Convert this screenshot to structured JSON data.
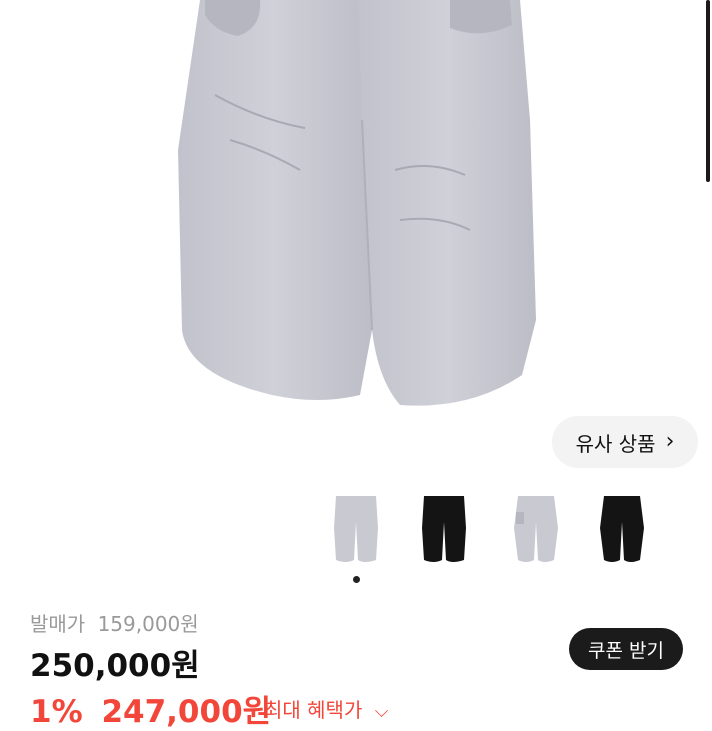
{
  "similar_button": {
    "label": "유사 상품",
    "icon": "chevron-right-icon"
  },
  "thumbnails": [
    {
      "name": "light-gray-pants-front",
      "color": "#c9c9d1"
    },
    {
      "name": "black-pants-front",
      "color": "#141414"
    },
    {
      "name": "light-gray-pants-side",
      "color": "#c9c9d1"
    },
    {
      "name": "black-pants-side",
      "color": "#141414"
    }
  ],
  "pricing": {
    "original_label": "발매가",
    "original_price": "159,000원",
    "price": "250,000원",
    "discount_percent": "1%",
    "final_price": "247,000원",
    "benefit_label": "최대 혜택가"
  },
  "coupon_button": {
    "label": "쿠폰 받기"
  },
  "colors": {
    "accent_red": "#f2463a",
    "pants_gray": "#c9c9d1",
    "dark": "#1b1b1b"
  }
}
